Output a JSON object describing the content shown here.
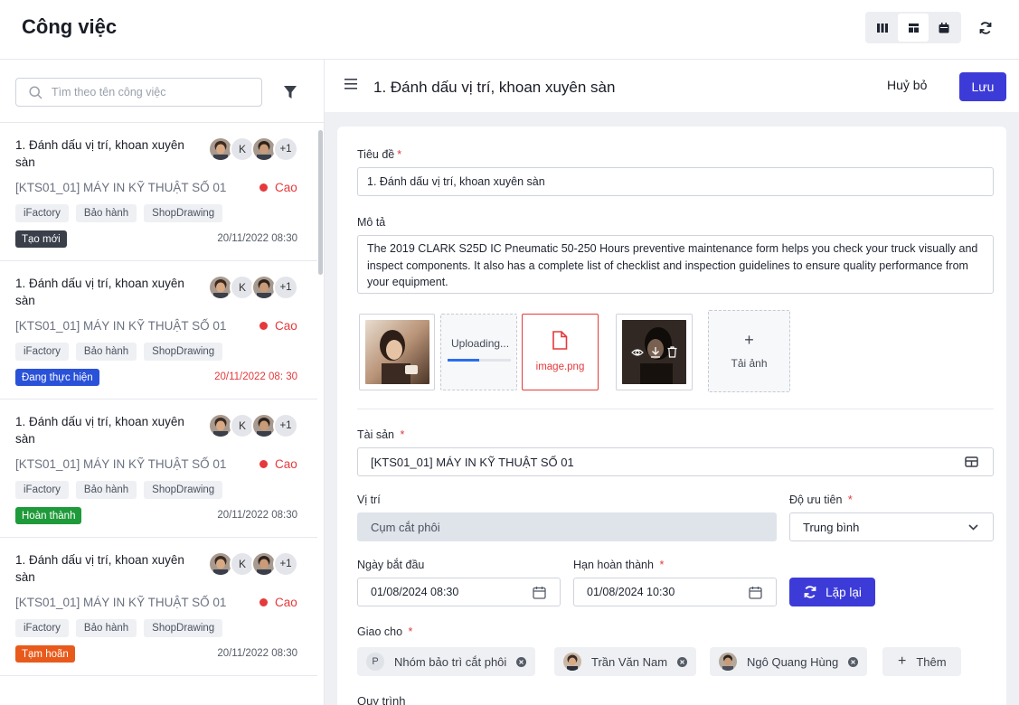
{
  "app": {
    "title": "Công việc"
  },
  "search": {
    "placeholder": "Tìm theo tên công việc"
  },
  "tasks": [
    {
      "title": "1. Đánh dấu vị trí, khoan xuyên sàn",
      "asset": "[KTS01_01] MÁY IN KỸ THUẬT SỐ 01",
      "priority": "Cao",
      "tags": [
        "iFactory",
        "Bảo hành",
        "ShopDrawing"
      ],
      "status": "Tạo mới",
      "status_color": "#3a3f4a",
      "date": "20/11/2022 08:30",
      "avatars": [
        "avatar-photo",
        "K",
        "avatar-photo"
      ],
      "more": "+1"
    },
    {
      "title": "1. Đánh dấu vị trí, khoan xuyên sàn",
      "asset": "[KTS01_01] MÁY IN KỸ THUẬT SỐ 01",
      "priority": "Cao",
      "tags": [
        "iFactory",
        "Bảo hành",
        "ShopDrawing"
      ],
      "status": "Đang thực hiện",
      "status_color": "#2a52d8",
      "date": "20/11/2022 08: 30",
      "avatars": [
        "avatar-photo",
        "K",
        "avatar-photo"
      ],
      "more": "+1"
    },
    {
      "title": "1. Đánh dấu vị trí, khoan xuyên sàn",
      "asset": "[KTS01_01] MÁY IN KỸ THUẬT SỐ 01",
      "priority": "Cao",
      "tags": [
        "iFactory",
        "Bảo hành",
        "ShopDrawing"
      ],
      "status": "Hoàn thành",
      "status_color": "#1f9a3a",
      "date": "20/11/2022 08:30",
      "avatars": [
        "avatar-photo",
        "K",
        "avatar-photo"
      ],
      "more": "+1"
    },
    {
      "title": "1. Đánh dấu vị trí, khoan xuyên sàn",
      "asset": "[KTS01_01] MÁY IN KỸ THUẬT SỐ 01",
      "priority": "Cao",
      "tags": [
        "iFactory",
        "Bảo hành",
        "ShopDrawing"
      ],
      "status": "Tạm hoãn",
      "status_color": "#e85a1b",
      "date": "20/11/2022 08:30",
      "avatars": [
        "avatar-photo",
        "K",
        "avatar-photo"
      ],
      "more": "+1"
    }
  ],
  "detail": {
    "header_title": "1. Đánh dấu vị trí, khoan xuyên sàn",
    "cancel_label": "Huỷ bỏ",
    "save_label": "Lưu",
    "title_label": "Tiêu đề",
    "title_value": "1. Đánh dấu vị trí, khoan xuyên sàn",
    "desc_label": "Mô tả",
    "desc_value": "The 2019 CLARK S25D IC Pneumatic 50-250 Hours preventive maintenance form helps you check your truck visually and inspect components. It also has a complete list of checklist and inspection guidelines to ensure quality performance from your equipment.",
    "uploading_text": "Uploading...",
    "upload_progress": 0.5,
    "error_file": "image.png",
    "add_image_label": "Tải ảnh",
    "asset_label": "Tài sản",
    "asset_value": "[KTS01_01] MÁY IN KỸ THUẬT SỐ 01",
    "location_label": "Vị trí",
    "location_value": "Cụm cắt phôi",
    "priority_label": "Độ ưu tiên",
    "priority_value": "Trung bình",
    "start_label": "Ngày bắt đầu",
    "start_value": "01/08/2024 08:30",
    "due_label": "Hạn hoàn thành",
    "due_value": "01/08/2024 10:30",
    "repeat_label": "Lặp lại",
    "assign_label": "Giao cho",
    "assignees": [
      {
        "initial": "P",
        "name": "Nhóm bảo trì cắt phôi"
      },
      {
        "initial": "",
        "name": "Trần Văn Nam"
      },
      {
        "initial": "",
        "name": "Ngô Quang Hùng"
      }
    ],
    "add_assignee_label": "Thêm",
    "workflow_label": "Quy trình"
  },
  "colors": {
    "accent": "#3d3bd8",
    "danger": "#e5393c"
  }
}
